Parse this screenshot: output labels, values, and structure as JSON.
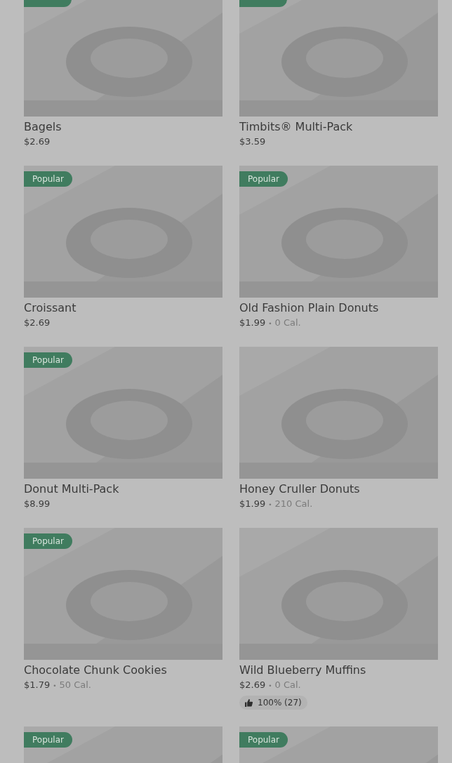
{
  "items": [
    {
      "name": "Bagels",
      "price": "$2.69",
      "popular": true
    },
    {
      "name": "Timbits® Multi-Pack",
      "price": "$3.59",
      "popular": true
    },
    {
      "name": "Croissant",
      "price": "$2.69",
      "popular": true,
      "popular_label": "Popular"
    },
    {
      "name": "Old Fashion Plain Donuts",
      "price": "$1.99",
      "calories": "0 Cal.",
      "popular": true,
      "popular_label": "Popular"
    },
    {
      "name": "Donut Multi-Pack",
      "price": "$8.99",
      "popular": true,
      "popular_label": "Popular"
    },
    {
      "name": "Honey Cruller Donuts",
      "price": "$1.99",
      "calories": "210 Cal.",
      "popular": false
    },
    {
      "name": "Chocolate Chunk Cookies",
      "price": "$1.79",
      "calories": "50 Cal.",
      "popular": true,
      "popular_label": "Popular"
    },
    {
      "name": "Wild Blueberry Muffins",
      "price": "$2.69",
      "calories": "0 Cal.",
      "rating": "100% (27)",
      "popular": false
    },
    {
      "popular": true,
      "popular_label": "Popular"
    },
    {
      "popular": true,
      "popular_label": "Popular"
    }
  ],
  "separator": "•"
}
